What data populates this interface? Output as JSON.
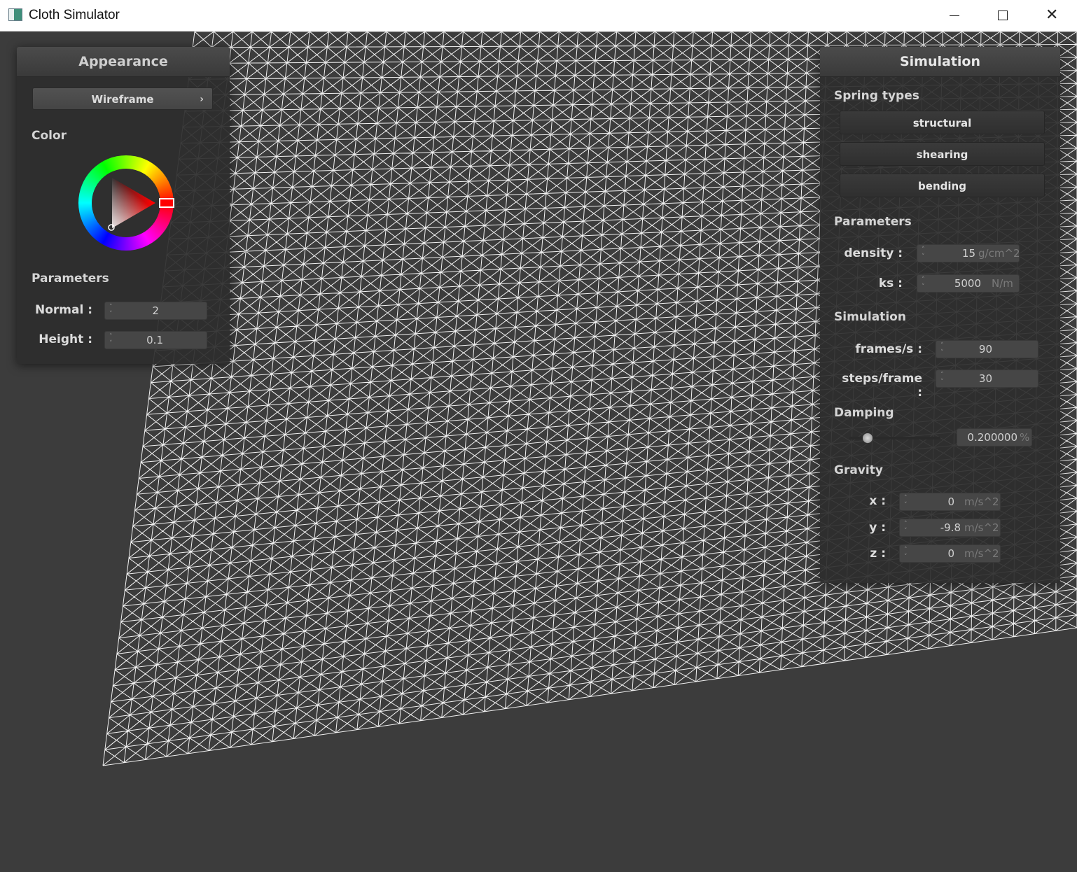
{
  "window": {
    "title": "Cloth Simulator"
  },
  "appearance": {
    "title": "Appearance",
    "shader_selected": "Wireframe",
    "color_label": "Color",
    "parameters_label": "Parameters",
    "normal": {
      "label": "Normal :",
      "value": "2"
    },
    "height": {
      "label": "Height :",
      "value": "0.1"
    },
    "color_hue": "#ff0000"
  },
  "simulation": {
    "title": "Simulation",
    "spring_types_label": "Spring types",
    "spring_buttons": [
      "structural",
      "shearing",
      "bending"
    ],
    "parameters_label": "Parameters",
    "density": {
      "label": "density :",
      "value": "15",
      "unit": "g/cm^2"
    },
    "ks": {
      "label": "ks :",
      "value": "5000",
      "unit": "N/m"
    },
    "simulation_label": "Simulation",
    "frames_per_s": {
      "label": "frames/s :",
      "value": "90"
    },
    "steps_per_frame": {
      "label": "steps/frame :",
      "value": "30"
    },
    "damping_label": "Damping",
    "damping": {
      "value": "0.200000",
      "unit": "%",
      "fraction": 0.2
    },
    "gravity_label": "Gravity",
    "gravity": {
      "x": {
        "label": "x :",
        "value": "0",
        "unit": "m/s^2"
      },
      "y": {
        "label": "y :",
        "value": "-9.8",
        "unit": "m/s^2"
      },
      "z": {
        "label": "z :",
        "value": "0",
        "unit": "m/s^2"
      }
    }
  }
}
